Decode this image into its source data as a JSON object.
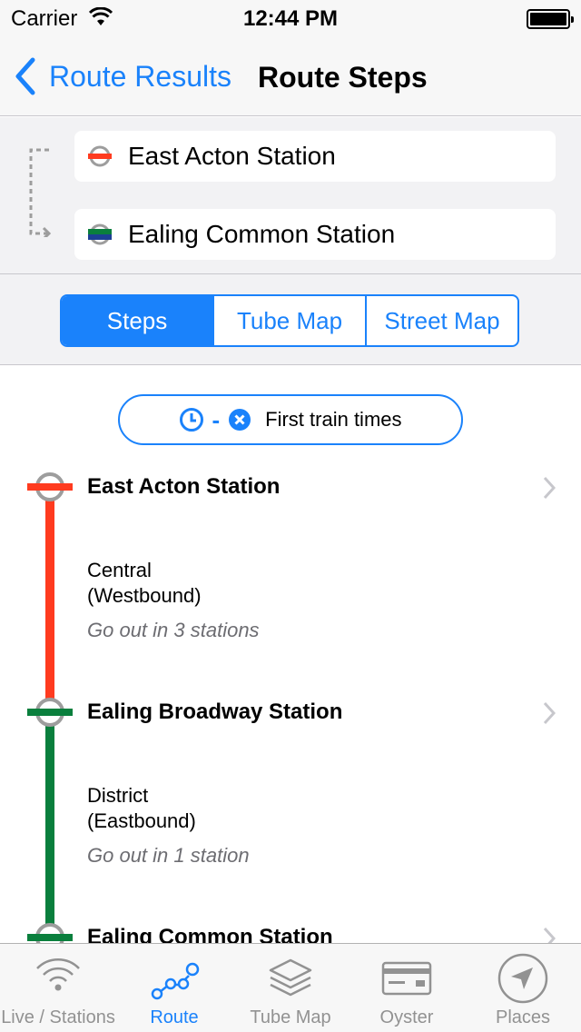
{
  "status_bar": {
    "carrier": "Carrier",
    "time": "12:44 PM"
  },
  "nav": {
    "back_label": "Route Results",
    "title": "Route Steps"
  },
  "journey": {
    "from": "East Acton Station",
    "to": "Ealing Common Station"
  },
  "segments": {
    "items": [
      "Steps",
      "Tube Map",
      "Street Map"
    ],
    "selected": "Steps"
  },
  "first_train": {
    "dash": "-",
    "label": "First train times"
  },
  "steps": [
    {
      "station": "East Acton Station",
      "line": "Central",
      "direction": "(Westbound)",
      "note": "Go out in 3 stations",
      "color": "#ff3b1f"
    },
    {
      "station": "Ealing Broadway Station",
      "line": "District",
      "direction": "(Eastbound)",
      "note": "Go out in 1 station",
      "color": "#0a7f3d"
    },
    {
      "station": "Ealing Common Station"
    }
  ],
  "tabs": [
    {
      "label": "Live / Stations",
      "icon": "signal-icon"
    },
    {
      "label": "Route",
      "icon": "route-icon",
      "active": true
    },
    {
      "label": "Tube Map",
      "icon": "layers-icon"
    },
    {
      "label": "Oyster",
      "icon": "card-icon"
    },
    {
      "label": "Places",
      "icon": "location-arrow-icon"
    }
  ],
  "colors": {
    "accent": "#1a82fb",
    "central": "#ff3b1f",
    "district": "#0a7f3d",
    "piccadilly": "#1c3f94",
    "roundel_ring": "#9d9d9d"
  }
}
